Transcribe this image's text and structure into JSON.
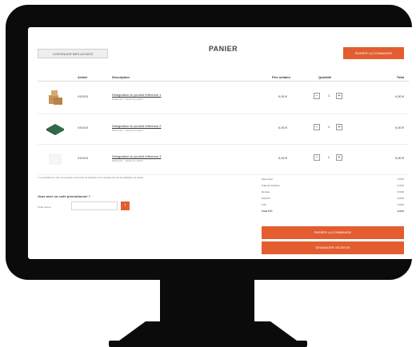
{
  "header": {
    "continue_label": "CONTINUER MES ACHATS",
    "title": "PANIER",
    "order_label": "PASSER LA COMMANDE"
  },
  "table": {
    "columns": [
      "Article",
      "Description",
      "Prix unitaire",
      "Quantité",
      "Total"
    ],
    "rows": [
      {
        "ref": "XXXXX",
        "description": "Désignation du produit référence 1",
        "sub": "Référence · Détail du produit",
        "unit": "0,00 €",
        "qty": "1",
        "total": "0,00 €"
      },
      {
        "ref": "XXXXX",
        "description": "Désignation du produit référence 2",
        "sub": "Référence · Détail du produit",
        "unit": "0,00 €",
        "qty": "1",
        "total": "0,00 €"
      },
      {
        "ref": "XXXXX",
        "description": "Désignation du produit référence 3",
        "sub": "Référence · Détail du produit",
        "unit": "0,00 €",
        "qty": "1",
        "total": "0,00 €"
      }
    ],
    "qty_minus": "−",
    "qty_plus": "+"
  },
  "note": "* Les détails de votre commande et les frais de livraison sont calculés lors de la validation du panier.",
  "promo": {
    "question": "Vous avez un code promotionnel ?",
    "label": "Code promo",
    "go_label": "›"
  },
  "summary": {
    "rows": [
      {
        "label": "Sous-total",
        "value": "0,00 €"
      },
      {
        "label": "Frais de livraison",
        "value": "0,00 €"
      },
      {
        "label": "Remise",
        "value": "0,00 €"
      },
      {
        "label": "Total HT",
        "value": "0,00 €"
      },
      {
        "label": "TVA",
        "value": "0,00 €"
      },
      {
        "label": "Total TTC",
        "value": "0,00 €"
      }
    ],
    "order_label": "PASSER LA COMMANDE",
    "quote_label": "DEMANDER UN DEVIS"
  },
  "colors": {
    "accent": "#e35d31",
    "bezel": "#0b0b0b"
  },
  "icons": {
    "row1": "cardboard-boxes-icon",
    "row2": "green-mat-icon",
    "row3": "white-product-icon"
  }
}
